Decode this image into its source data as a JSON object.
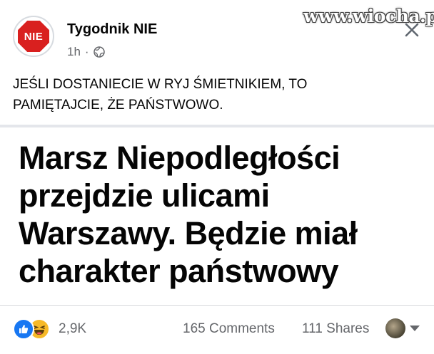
{
  "post": {
    "page_name": "Tygodnik NIE",
    "avatar_text": "NIE",
    "time": "1h",
    "separator": "·",
    "watermark": "www.wiocha.pl",
    "text_line1": "JEŚLI DOSTANIECIE W RYJ ŚMIETNIKIEM, TO",
    "text_line2": "PAMIĘTAJCIE, ŻE PAŃSTWOWO."
  },
  "link_card": {
    "headline_lines": [
      "Marsz Niepodległości",
      "przejdzie ulicami",
      "Warszawy. Będzie miał",
      "charakter państwowy"
    ]
  },
  "footer": {
    "reaction_count": "2,9K",
    "comments": "165 Comments",
    "shares": "111 Shares"
  },
  "icons": {
    "close": "close-icon",
    "globe": "globe-icon",
    "like": "like-icon",
    "haha": "haha-icon"
  },
  "colors": {
    "stop_red": "#d9201f",
    "like_blue": "#1877f2",
    "haha_yellow": "#f7b928",
    "secondary_text": "#65676b"
  }
}
